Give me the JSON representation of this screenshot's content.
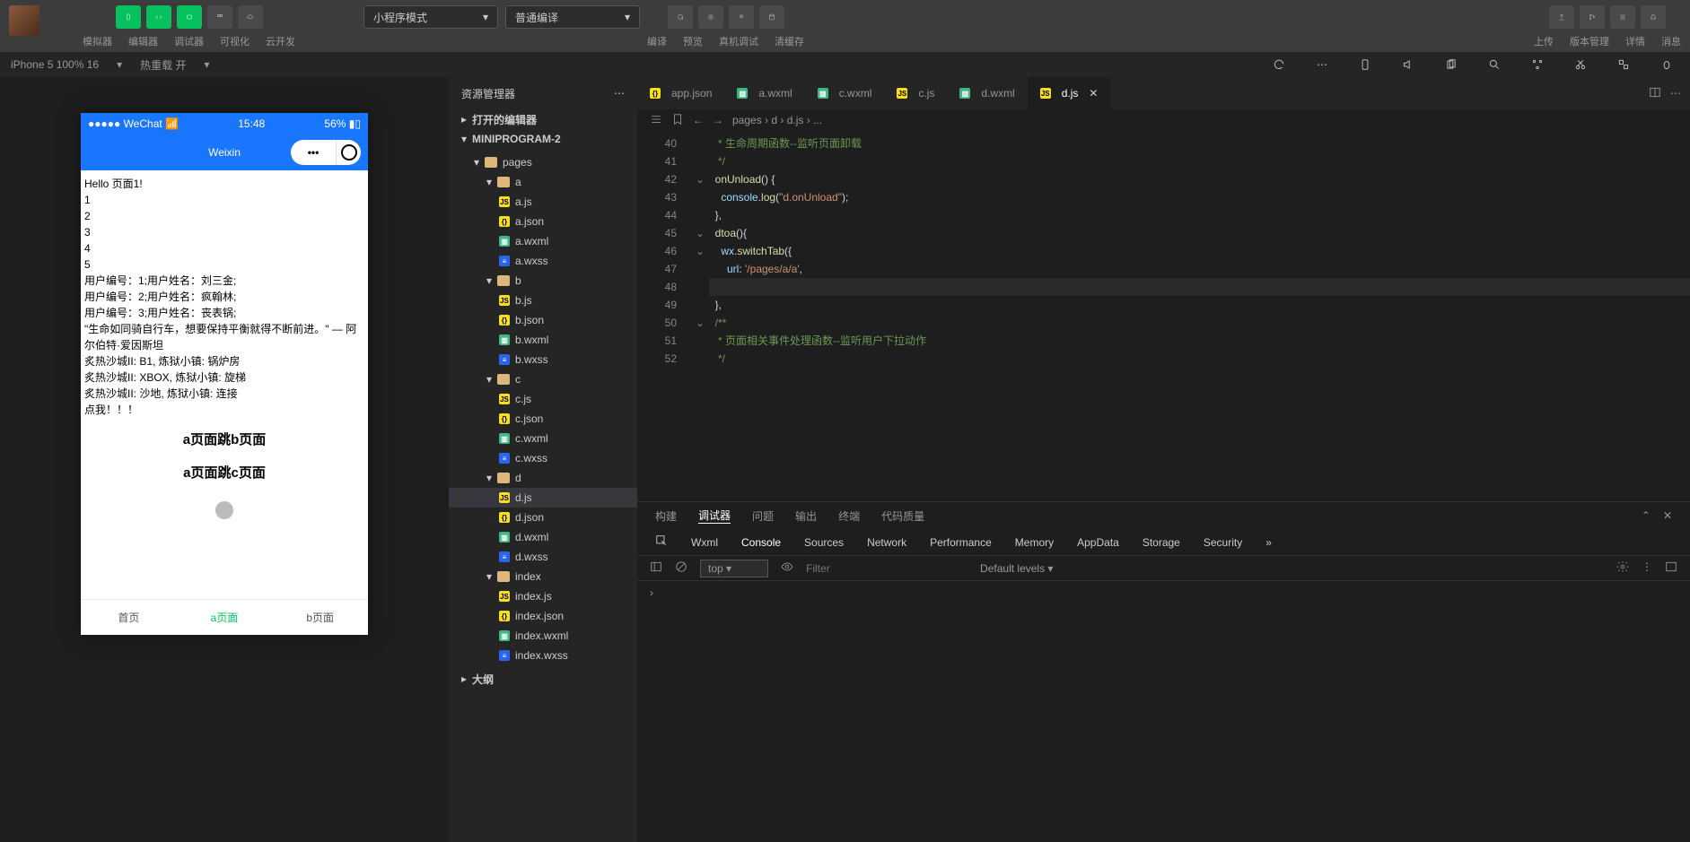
{
  "top": {
    "labels": [
      "模拟器",
      "编辑器",
      "调试器",
      "可视化",
      "云开发"
    ],
    "mode_dropdown": "小程序模式",
    "compile_dropdown": "普通编译",
    "compile_labels": [
      "编译",
      "预览",
      "真机调试",
      "清缓存"
    ],
    "right_labels": [
      "上传",
      "版本管理",
      "详情",
      "消息"
    ]
  },
  "status": {
    "device": "iPhone 5 100% 16",
    "hot": "热重载 开"
  },
  "phone": {
    "carrier": "●●●●● WeChat",
    "time": "15:48",
    "battery": "56%",
    "title": "Weixin",
    "lines": [
      "Hello 页面1!",
      "1",
      "2",
      "3",
      "4",
      "5",
      "用户编号：1;用户姓名：刘三金;",
      "用户编号：2;用户姓名：疯翰林;",
      "用户编号：3;用户姓名：丧表锅;",
      "\"生命如同骑自行车，想要保持平衡就得不断前进。\" — 阿尔伯特·爱因斯坦",
      "炙热沙城II: B1, 炼狱小镇: 锅炉房",
      "炙热沙城II: XBOX, 炼狱小镇: 旋梯",
      "炙热沙城II: 沙地, 炼狱小镇: 连接",
      "点我！！！"
    ],
    "nav1": "a页面跳b页面",
    "nav2": "a页面跳c页面",
    "tabs": [
      "首页",
      "a页面",
      "b页面"
    ],
    "active_tab": 1
  },
  "explorer": {
    "title": "资源管理器",
    "open_editors": "打开的编辑器",
    "project": "MINIPROGRAM-2",
    "outline": "大纲",
    "tree": [
      {
        "n": "pages",
        "t": "folder",
        "d": 1,
        "o": true
      },
      {
        "n": "a",
        "t": "folder",
        "d": 2,
        "o": true
      },
      {
        "n": "a.js",
        "t": "js",
        "d": 3
      },
      {
        "n": "a.json",
        "t": "json",
        "d": 3
      },
      {
        "n": "a.wxml",
        "t": "wxml",
        "d": 3
      },
      {
        "n": "a.wxss",
        "t": "wxss",
        "d": 3
      },
      {
        "n": "b",
        "t": "folder",
        "d": 2,
        "o": true
      },
      {
        "n": "b.js",
        "t": "js",
        "d": 3
      },
      {
        "n": "b.json",
        "t": "json",
        "d": 3
      },
      {
        "n": "b.wxml",
        "t": "wxml",
        "d": 3
      },
      {
        "n": "b.wxss",
        "t": "wxss",
        "d": 3
      },
      {
        "n": "c",
        "t": "folder",
        "d": 2,
        "o": true
      },
      {
        "n": "c.js",
        "t": "js",
        "d": 3
      },
      {
        "n": "c.json",
        "t": "json",
        "d": 3
      },
      {
        "n": "c.wxml",
        "t": "wxml",
        "d": 3
      },
      {
        "n": "c.wxss",
        "t": "wxss",
        "d": 3
      },
      {
        "n": "d",
        "t": "folder",
        "d": 2,
        "o": true
      },
      {
        "n": "d.js",
        "t": "js",
        "d": 3,
        "sel": true
      },
      {
        "n": "d.json",
        "t": "json",
        "d": 3
      },
      {
        "n": "d.wxml",
        "t": "wxml",
        "d": 3
      },
      {
        "n": "d.wxss",
        "t": "wxss",
        "d": 3
      },
      {
        "n": "index",
        "t": "folder",
        "d": 2,
        "o": true
      },
      {
        "n": "index.js",
        "t": "js",
        "d": 3
      },
      {
        "n": "index.json",
        "t": "json",
        "d": 3
      },
      {
        "n": "index.wxml",
        "t": "wxml",
        "d": 3
      },
      {
        "n": "index.wxss",
        "t": "wxss",
        "d": 3
      }
    ]
  },
  "tabs": [
    {
      "n": "app.json",
      "t": "json"
    },
    {
      "n": "a.wxml",
      "t": "wxml"
    },
    {
      "n": "c.wxml",
      "t": "wxml"
    },
    {
      "n": "c.js",
      "t": "js"
    },
    {
      "n": "d.wxml",
      "t": "wxml"
    },
    {
      "n": "d.js",
      "t": "js",
      "active": true
    }
  ],
  "breadcrumb": [
    "pages",
    "d",
    "d.js",
    "..."
  ],
  "code": {
    "start": 40,
    "lines": [
      {
        "seg": [
          {
            "c": "c-comment",
            "t": "   * 生命周期函数--监听页面卸载"
          }
        ]
      },
      {
        "seg": [
          {
            "c": "c-comment",
            "t": "   */"
          }
        ]
      },
      {
        "seg": [
          {
            "c": "c-fn",
            "t": "  onUnload"
          },
          {
            "c": "c-punc",
            "t": "() {"
          }
        ]
      },
      {
        "seg": [
          {
            "c": "c-obj",
            "t": "    console"
          },
          {
            "c": "c-punc",
            "t": "."
          },
          {
            "c": "c-fn",
            "t": "log"
          },
          {
            "c": "c-punc",
            "t": "("
          },
          {
            "c": "c-str",
            "t": "\"d.onUnload\""
          },
          {
            "c": "c-punc",
            "t": ");"
          }
        ]
      },
      {
        "seg": [
          {
            "c": "c-punc",
            "t": "  },"
          }
        ]
      },
      {
        "seg": [
          {
            "c": "c-fn",
            "t": "  dtoa"
          },
          {
            "c": "c-punc",
            "t": "(){"
          }
        ]
      },
      {
        "seg": [
          {
            "c": "c-obj",
            "t": "    wx"
          },
          {
            "c": "c-punc",
            "t": "."
          },
          {
            "c": "c-fn",
            "t": "switchTab"
          },
          {
            "c": "c-punc",
            "t": "({"
          }
        ]
      },
      {
        "seg": [
          {
            "c": "c-obj",
            "t": "      url"
          },
          {
            "c": "c-punc",
            "t": ": "
          },
          {
            "c": "c-str",
            "t": "'/pages/a/a'"
          },
          {
            "c": "c-punc",
            "t": ","
          }
        ]
      },
      {
        "seg": [
          {
            "c": "c-punc",
            "t": "    })"
          }
        ]
      },
      {
        "seg": [
          {
            "c": "c-punc",
            "t": "  },"
          }
        ]
      },
      {
        "seg": [
          {
            "c": "c-comment",
            "t": "  /**"
          }
        ]
      },
      {
        "seg": [
          {
            "c": "c-comment",
            "t": "   * 页面相关事件处理函数--监听用户下拉动作"
          }
        ]
      },
      {
        "seg": [
          {
            "c": "c-comment",
            "t": "   */"
          }
        ]
      }
    ]
  },
  "panel": {
    "tabs": [
      "构建",
      "调试器",
      "问题",
      "输出",
      "终端",
      "代码质量"
    ],
    "active": 1,
    "devtabs": [
      "Wxml",
      "Console",
      "Sources",
      "Network",
      "Performance",
      "Memory",
      "AppData",
      "Storage",
      "Security"
    ],
    "devactive": 1,
    "top": "top",
    "filter_ph": "Filter",
    "levels": "Default levels"
  }
}
